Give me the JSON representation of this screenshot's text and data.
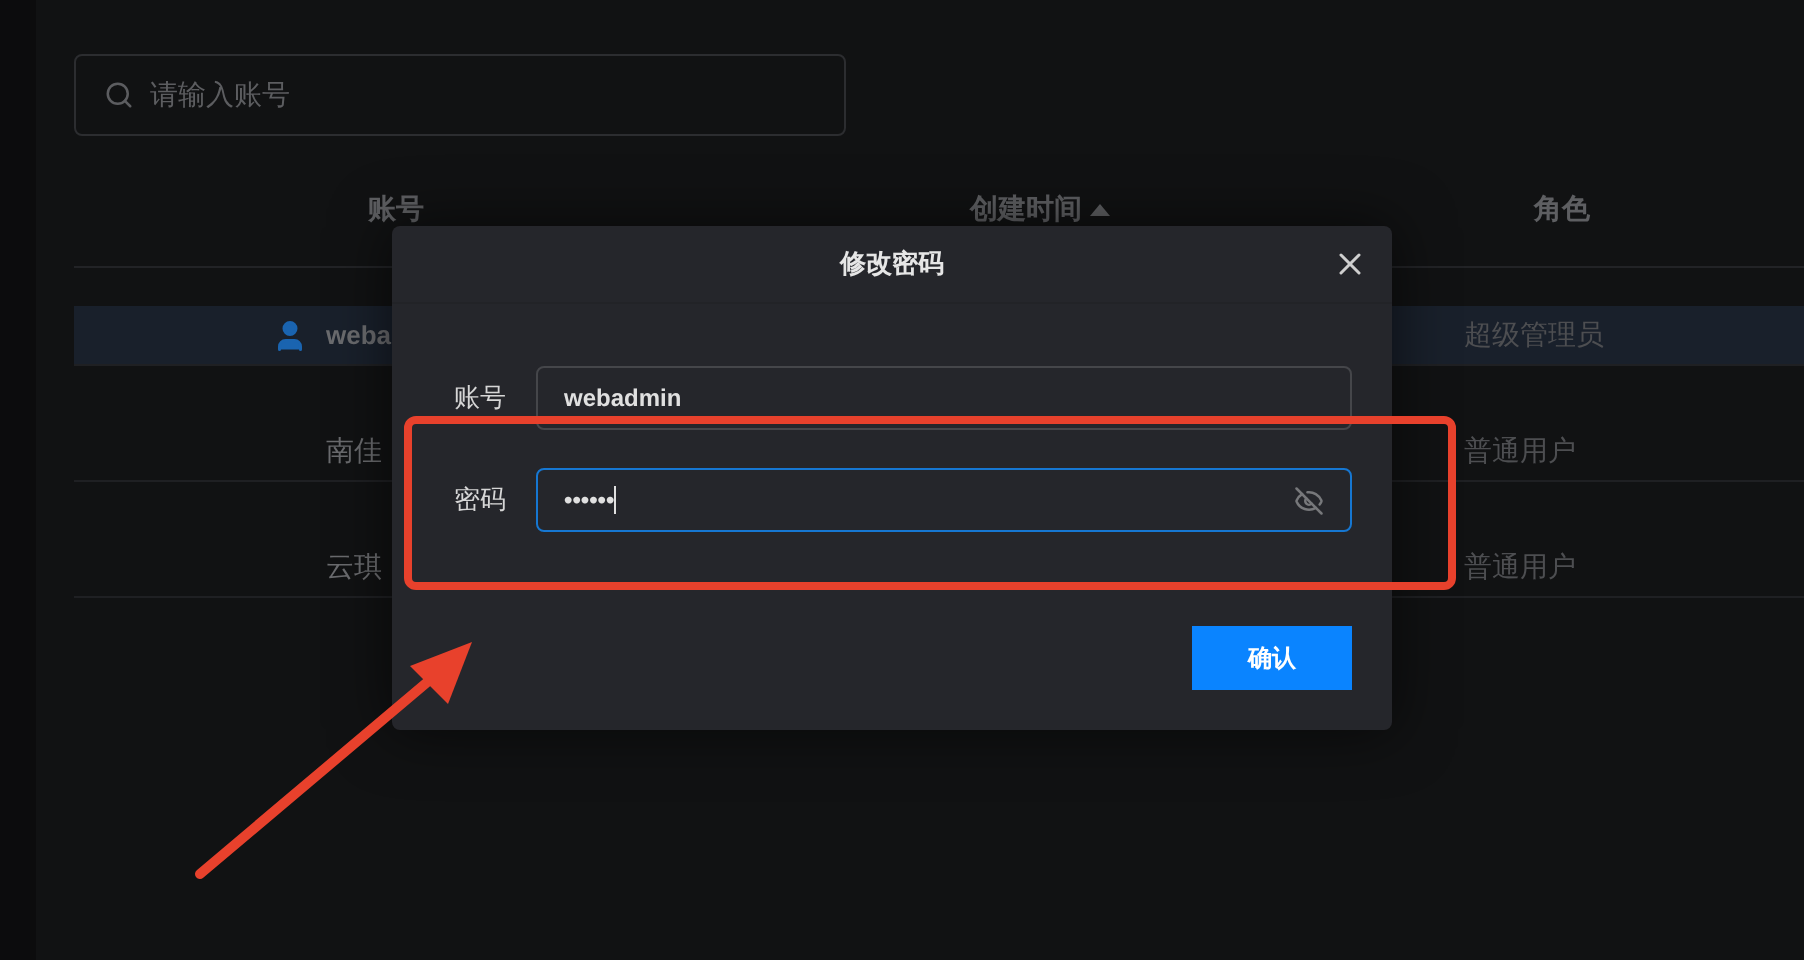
{
  "search": {
    "placeholder": "请输入账号"
  },
  "table": {
    "columns": [
      {
        "label": "账号",
        "sorted": false
      },
      {
        "label": "创建时间",
        "sorted": true
      },
      {
        "label": "角色",
        "sorted": false
      }
    ],
    "rows": [
      {
        "account": "weba",
        "avatar": true,
        "role": "超级管理员",
        "selected": true
      },
      {
        "account": "南佳",
        "avatar": false,
        "role": "普通用户",
        "selected": false
      },
      {
        "account": "云琪",
        "avatar": false,
        "role": "普通用户",
        "selected": false
      }
    ]
  },
  "dialog": {
    "title": "修改密码",
    "fields": [
      {
        "label": "账号",
        "value": "webadmin",
        "kind": "text",
        "focused": false
      },
      {
        "label": "密码",
        "value": "••••••",
        "kind": "password",
        "focused": true
      }
    ],
    "confirm": "确认"
  },
  "annotation": {
    "color": "#e8412c"
  }
}
